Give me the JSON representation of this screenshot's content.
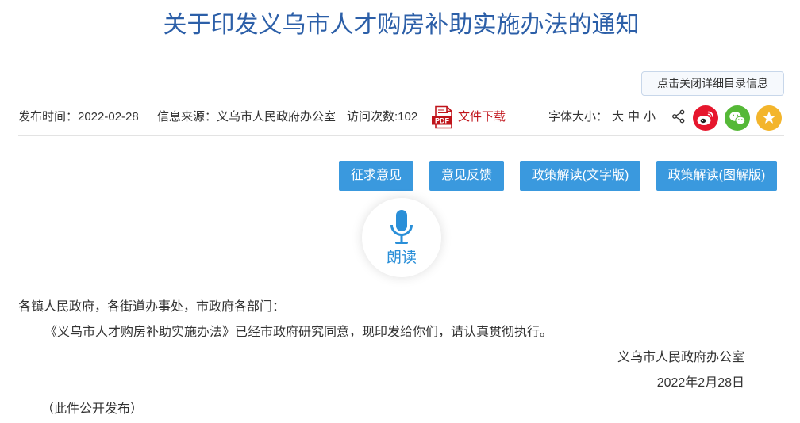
{
  "title": "关于印发义乌市人才购房补助实施办法的通知",
  "catalog_toggle": {
    "label": "点击关闭详细目录信息"
  },
  "meta": {
    "publish_time": "发布时间：2022-02-28",
    "source": "信息来源：义乌市人民政府办公室",
    "visits": "访问次数:102",
    "download": {
      "icon": "pdf-file-icon",
      "icon_text": "PDF",
      "label": "文件下载"
    },
    "font_size": {
      "label": "字体大小：",
      "options": [
        "大",
        "中",
        "小"
      ]
    }
  },
  "share": {
    "icons": [
      "share-icon",
      "weibo-icon",
      "wechat-icon",
      "favorite-star-icon"
    ]
  },
  "actions": [
    "征求意见",
    "意见反馈",
    "政策解读(文字版)",
    "政策解读(图解版)"
  ],
  "read_aloud": {
    "icon": "microphone-icon",
    "label": "朗读"
  },
  "body": {
    "salutation": "各镇人民政府，各街道办事处，市政府各部门：",
    "paragraph": "《义乌市人才购房补助实施办法》已经市政府研究同意，现印发给你们，请认真贯彻执行。",
    "issuer": "义乌市人民政府办公室",
    "date": "2022年2月28日",
    "note": "（此件公开发布）"
  },
  "colors": {
    "title": "#2c5fa8",
    "action_button": "#3a99de",
    "download_red": "#c0141b",
    "weibo": "#e6162d",
    "wechat": "#55b837",
    "favorite": "#f3b52c",
    "read_aloud": "#2a8fd8"
  }
}
